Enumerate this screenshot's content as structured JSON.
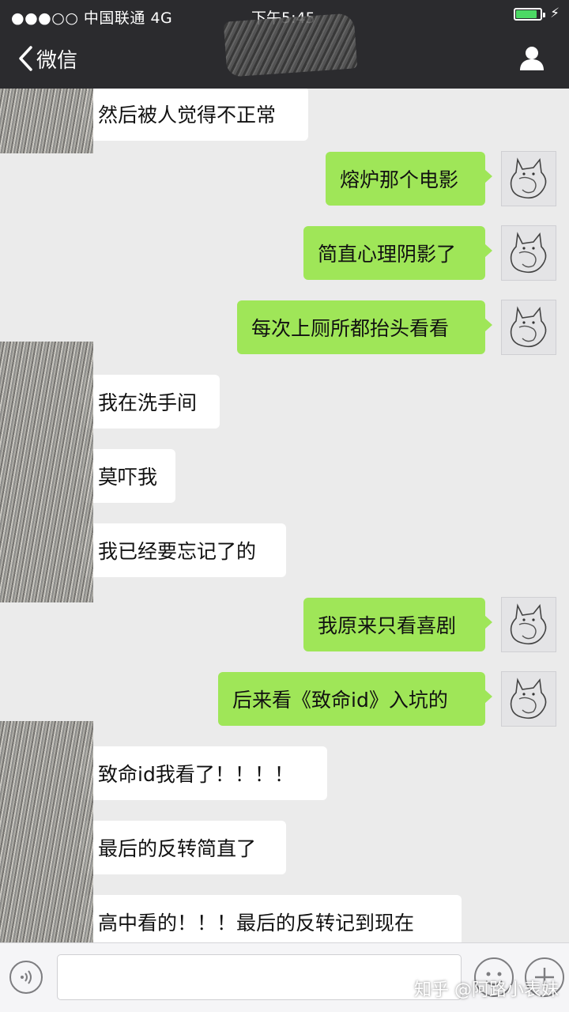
{
  "status_bar": {
    "carrier": "●●●○○ 中国联通   4G",
    "time": "下午5:45",
    "battery_color": "#4cd964"
  },
  "nav": {
    "back_label": "微信",
    "back_icon": "chevron-left-icon",
    "profile_icon": "person-icon"
  },
  "messages": [
    {
      "side": "in",
      "text": "然后被人觉得不正常"
    },
    {
      "side": "out",
      "text": "熔炉那个电影"
    },
    {
      "side": "out",
      "text": "简直心理阴影了"
    },
    {
      "side": "out",
      "text": "每次上厕所都抬头看看"
    },
    {
      "side": "in",
      "text": "我在洗手间"
    },
    {
      "side": "in",
      "text": "莫吓我"
    },
    {
      "side": "in",
      "text": "我已经要忘记了的"
    },
    {
      "side": "out",
      "text": "我原来只看喜剧"
    },
    {
      "side": "out",
      "text": "后来看《致命id》入坑的"
    },
    {
      "side": "in",
      "text": "致命id我看了！！！！"
    },
    {
      "side": "in",
      "text": "最后的反转简直了"
    },
    {
      "side": "in",
      "text": "高中看的！！！最后的反转记到现在"
    }
  ],
  "input_bar": {
    "voice_icon": "voice-icon",
    "emoji_icon": "emoji-icon",
    "plus_icon": "plus-icon",
    "text_value": ""
  },
  "colors": {
    "outgoing_bubble": "#9fe658",
    "incoming_bubble": "#ffffff",
    "background": "#ebebeb",
    "topbar": "#2b2b2e"
  },
  "watermark": "知乎 @阿路小表妹"
}
